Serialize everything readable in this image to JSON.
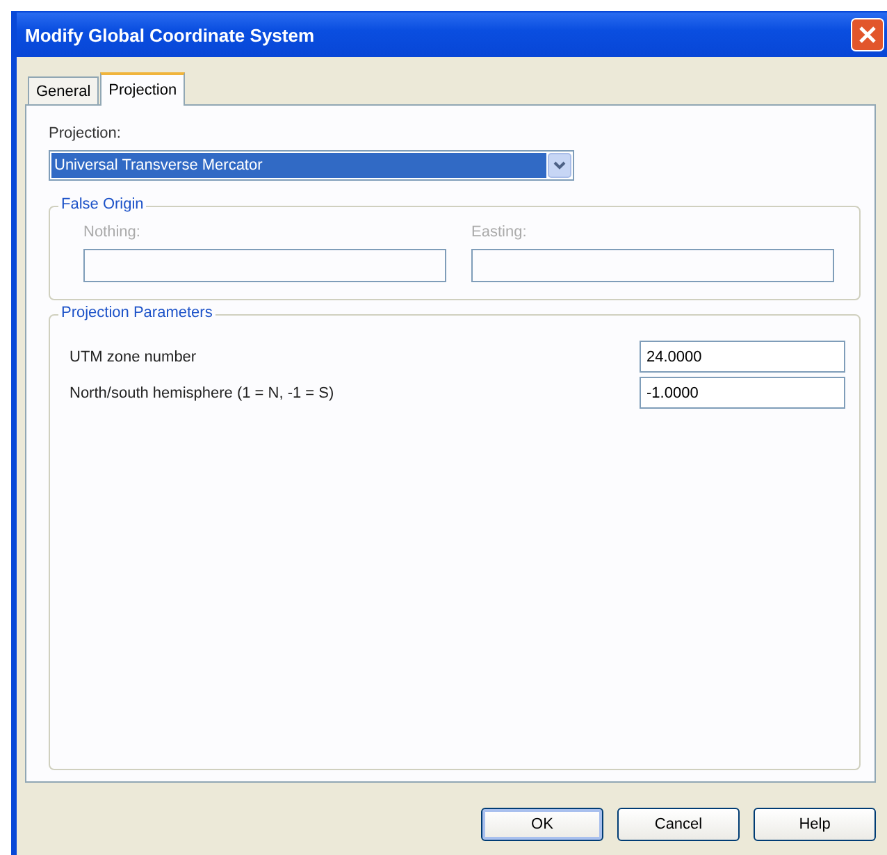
{
  "window": {
    "title": "Modify Global Coordinate System"
  },
  "tabs": [
    {
      "label": "General",
      "selected": false
    },
    {
      "label": "Projection",
      "selected": true
    }
  ],
  "projection": {
    "label": "Projection:",
    "value": "Universal Transverse Mercator"
  },
  "false_origin": {
    "title": "False Origin",
    "disabled": true,
    "fields": [
      {
        "label": "Nothing:"
      },
      {
        "label": "Easting:"
      }
    ]
  },
  "parameters": {
    "title": "Projection Parameters",
    "rows": [
      {
        "label": "UTM zone number",
        "value": "24.0000"
      },
      {
        "label": "North/south hemisphere (1 = N, -1 = S)",
        "value": "-1.0000"
      }
    ]
  },
  "buttons": [
    {
      "label": "OK",
      "default": true
    },
    {
      "label": "Cancel",
      "default": false
    },
    {
      "label": "Help",
      "default": false
    }
  ]
}
